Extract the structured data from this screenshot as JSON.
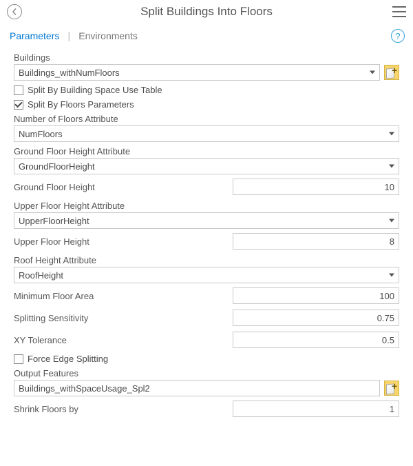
{
  "header": {
    "title": "Split Buildings Into Floors"
  },
  "tabs": {
    "parameters": "Parameters",
    "environments": "Environments"
  },
  "labels": {
    "buildings": "Buildings",
    "splitBySpaceUse": "Split By Building Space Use Table",
    "splitByFloors": "Split By Floors Parameters",
    "numFloorsAttr": "Number of Floors Attribute",
    "groundHeightAttr": "Ground Floor Height Attribute",
    "groundHeight": "Ground Floor Height",
    "upperHeightAttr": "Upper Floor Height Attribute",
    "upperHeight": "Upper Floor Height",
    "roofHeightAttr": "Roof Height Attribute",
    "minFloorArea": "Minimum Floor Area",
    "splitSensitivity": "Splitting Sensitivity",
    "xyTolerance": "XY Tolerance",
    "forceEdge": "Force Edge Splitting",
    "outputFeatures": "Output Features",
    "shrinkBy": "Shrink Floors by"
  },
  "values": {
    "buildings": "Buildings_withNumFloors",
    "splitBySpaceUse": false,
    "splitByFloors": true,
    "numFloorsAttr": "NumFloors",
    "groundHeightAttr": "GroundFloorHeight",
    "groundHeight": "10",
    "upperHeightAttr": "UpperFloorHeight",
    "upperHeight": "8",
    "roofHeightAttr": "RoofHeight",
    "minFloorArea": "100",
    "splitSensitivity": "0.75",
    "xyTolerance": "0.5",
    "forceEdge": false,
    "outputFeatures": "Buildings_withSpaceUsage_Spl2",
    "shrinkBy": "1"
  }
}
